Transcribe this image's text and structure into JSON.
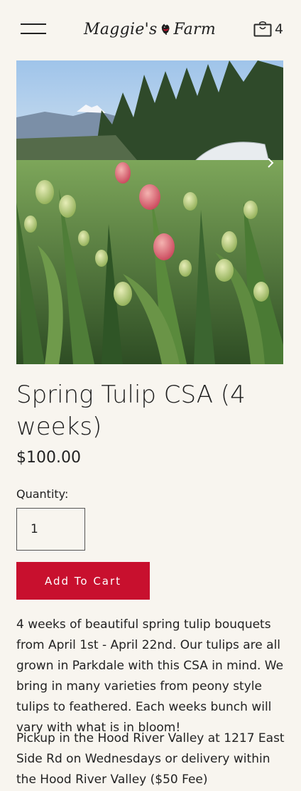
{
  "header": {
    "logo_text_left": "Maggie's",
    "logo_text_right": "Farm",
    "cart_count": "4",
    "icons": [
      "menu-icon",
      "logo-dog-icon",
      "cart-icon"
    ]
  },
  "gallery": {
    "next_icon": "chevron-right-icon"
  },
  "product": {
    "title": "Spring Tulip CSA (4 weeks)",
    "price": "$100.00",
    "quantity_label": "Quantity:",
    "quantity_value": "1",
    "add_to_cart_label": "Add To Cart",
    "description_1": "4 weeks of beautiful spring tulip bouquets from April 1st - April 22nd. Our tulips are all grown in Parkdale with this CSA in mind. We bring in many varieties from peony style tulips to feathered. Each weeks bunch will vary with what is in bloom!",
    "description_2": "Pickup in the Hood River Valley at 1217 East Side Rd on Wednesdays or delivery within the Hood River Valley ($50 Fee)"
  },
  "colors": {
    "background": "#f8f5ef",
    "accent": "#c8102e",
    "text": "#222222"
  }
}
